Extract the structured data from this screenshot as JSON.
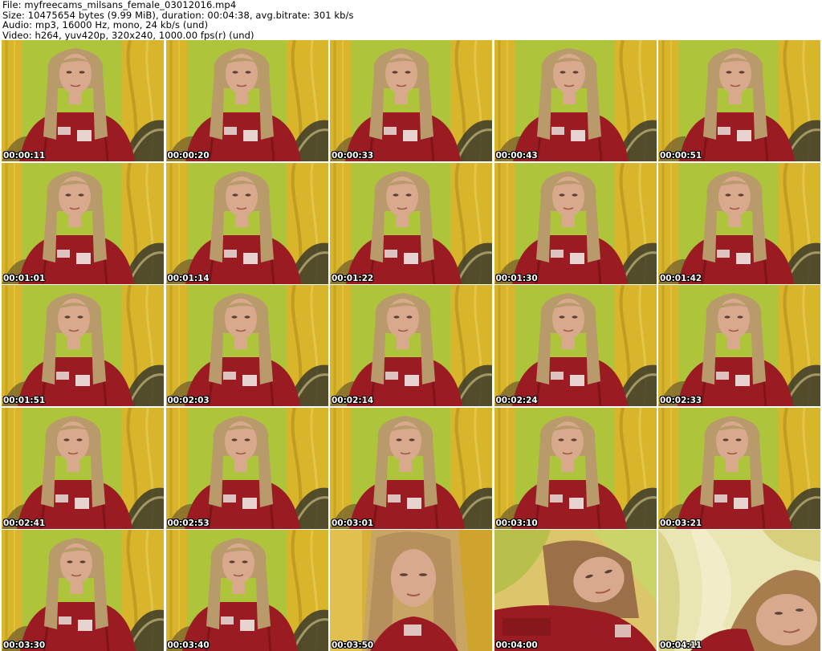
{
  "header": {
    "file": "File: myfreecams_milsans_female_03012016.mp4",
    "size": "Size: 10475654 bytes (9.99 MiB), duration: 00:04:38, avg.bitrate: 301 kb/s",
    "audio": "Audio: mp3, 16000 Hz, mono, 24 kb/s (und)",
    "video": "Video: h264, yuv420p, 320x240, 1000.00 fps(r) (und)"
  },
  "frames": [
    {
      "timestamp": "00:00:11",
      "scene": "seated"
    },
    {
      "timestamp": "00:00:20",
      "scene": "seated"
    },
    {
      "timestamp": "00:00:33",
      "scene": "seated"
    },
    {
      "timestamp": "00:00:43",
      "scene": "seated"
    },
    {
      "timestamp": "00:00:51",
      "scene": "seated"
    },
    {
      "timestamp": "00:01:01",
      "scene": "seated"
    },
    {
      "timestamp": "00:01:14",
      "scene": "seated"
    },
    {
      "timestamp": "00:01:22",
      "scene": "seated"
    },
    {
      "timestamp": "00:01:30",
      "scene": "seated"
    },
    {
      "timestamp": "00:01:42",
      "scene": "seated"
    },
    {
      "timestamp": "00:01:51",
      "scene": "seated"
    },
    {
      "timestamp": "00:02:03",
      "scene": "seated"
    },
    {
      "timestamp": "00:02:14",
      "scene": "seated"
    },
    {
      "timestamp": "00:02:24",
      "scene": "seated"
    },
    {
      "timestamp": "00:02:33",
      "scene": "seated"
    },
    {
      "timestamp": "00:02:41",
      "scene": "seated"
    },
    {
      "timestamp": "00:02:53",
      "scene": "seated"
    },
    {
      "timestamp": "00:03:01",
      "scene": "seated"
    },
    {
      "timestamp": "00:03:10",
      "scene": "seated"
    },
    {
      "timestamp": "00:03:21",
      "scene": "seated"
    },
    {
      "timestamp": "00:03:30",
      "scene": "seated"
    },
    {
      "timestamp": "00:03:40",
      "scene": "seated"
    },
    {
      "timestamp": "00:03:50",
      "scene": "closeup"
    },
    {
      "timestamp": "00:04:00",
      "scene": "leaning"
    },
    {
      "timestamp": "00:04:11",
      "scene": "lying"
    }
  ],
  "colors": {
    "wall_green": "#aec43a",
    "curtain_yellow": "#d8b52a",
    "hoodie_red": "#9a1c22",
    "hair_blonde": "#b99a6a",
    "skin": "#d9a98e",
    "timestamp_text": "#ffffff"
  }
}
